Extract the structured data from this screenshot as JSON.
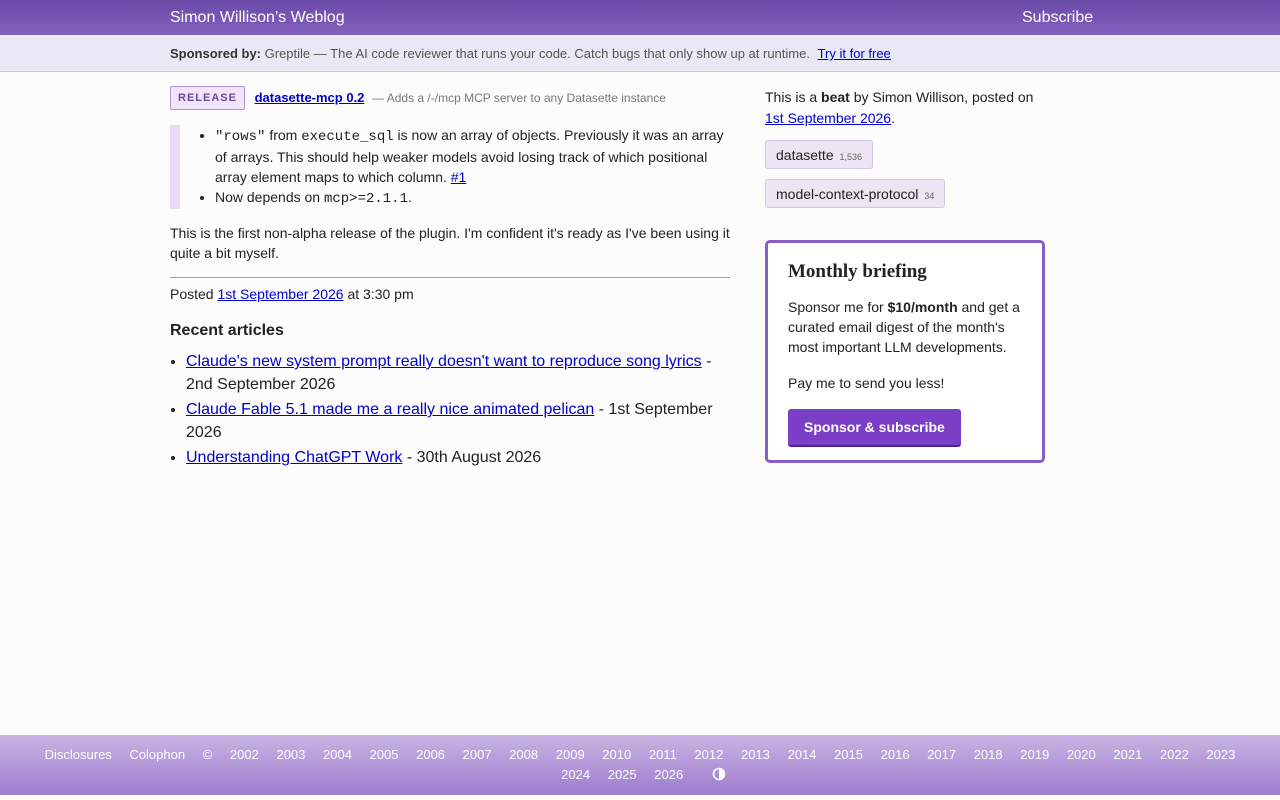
{
  "header": {
    "site_title": "Simon Willison’s Weblog",
    "subscribe": "Subscribe"
  },
  "sponsor": {
    "label": "Sponsored by:",
    "text": "Greptile — The AI code reviewer that runs your code. Catch bugs that only show up at runtime.",
    "link": "Try it for free"
  },
  "release": {
    "badge": "RELEASE",
    "name": "datasette-mcp 0.2",
    "description": "— Adds a /-/mcp MCP server to any Datasette instance",
    "notes": [
      {
        "code1": "\"rows\"",
        "mid1": "from",
        "code2": "execute_sql",
        "rest": "is now an array of objects. Previously it was an array of arrays. This should help weaker models avoid losing track of which positional array element maps to which column.",
        "link": "#1"
      },
      {
        "pre": "Now depends on",
        "code": "mcp>=2.1.1",
        "post": "."
      }
    ],
    "paragraph": "This is the first non-alpha release of the plugin. I'm confident it's ready as I've been using it quite a bit myself.",
    "posted_label": "Posted",
    "posted_date": "1st September 2026",
    "posted_time": "at 3:30 pm"
  },
  "recent": {
    "heading": "Recent articles",
    "items": [
      {
        "title": "Claude's new system prompt really doesn't want to reproduce song lyrics",
        "date": "- 2nd September 2026"
      },
      {
        "title": "Claude Fable 5.1 made me a really nice animated pelican",
        "date": "- 1st September 2026"
      },
      {
        "title": "Understanding ChatGPT Work",
        "date": "- 30th August 2026"
      }
    ]
  },
  "sidebar": {
    "meta_pre": "This is a",
    "meta_beat": "beat",
    "meta_mid": "by Simon Willison, posted on",
    "meta_date": "1st September 2026",
    "meta_end": ".",
    "tags": [
      {
        "name": "datasette",
        "count": "1,536"
      },
      {
        "name": "model-context-protocol",
        "count": "34"
      }
    ],
    "briefing": {
      "title": "Monthly briefing",
      "p1_pre": "Sponsor me for",
      "p1_bold": "$10/month",
      "p1_post": "and get a curated email digest of the month's most important LLM developments.",
      "p2": "Pay me to send you less!",
      "button": "Sponsor & subscribe"
    }
  },
  "footer": {
    "links": [
      "Disclosures",
      "Colophon"
    ],
    "copyright": "©",
    "years_line1": [
      "2002",
      "2003",
      "2004",
      "2005",
      "2006",
      "2007",
      "2008",
      "2009",
      "2010",
      "2011",
      "2012",
      "2013",
      "2014",
      "2015",
      "2016",
      "2017",
      "2018",
      "2019",
      "2020",
      "2021",
      "2022",
      "2023"
    ],
    "years_line2": [
      "2024",
      "2025",
      "2026"
    ],
    "theme_icon": "contrast-icon"
  }
}
